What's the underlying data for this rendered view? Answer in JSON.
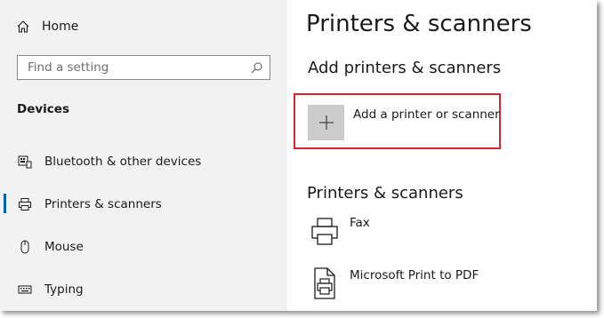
{
  "sidebar": {
    "home": {
      "label": "Home",
      "icon": "home-icon"
    },
    "search": {
      "placeholder": "Find a setting",
      "icon": "search-icon"
    },
    "section_title": "Devices",
    "items": [
      {
        "label": "Bluetooth & other devices",
        "icon": "bluetooth-devices-icon"
      },
      {
        "label": "Printers & scanners",
        "icon": "printer-icon",
        "selected": true
      },
      {
        "label": "Mouse",
        "icon": "mouse-icon"
      },
      {
        "label": "Typing",
        "icon": "keyboard-icon"
      }
    ]
  },
  "main": {
    "title": "Printers & scanners",
    "add_section_title": "Add printers & scanners",
    "add_button_label": "Add a printer or scanner",
    "list_section_title": "Printers & scanners",
    "printers": [
      {
        "name": "Fax",
        "icon": "printer-icon"
      },
      {
        "name": "Microsoft Print to PDF",
        "icon": "printer-document-icon"
      }
    ]
  },
  "colors": {
    "sidebar_bg": "#f2f2f2",
    "accent": "#0063b1",
    "highlight_box": "#d9232e",
    "add_tile": "#cccccc"
  }
}
